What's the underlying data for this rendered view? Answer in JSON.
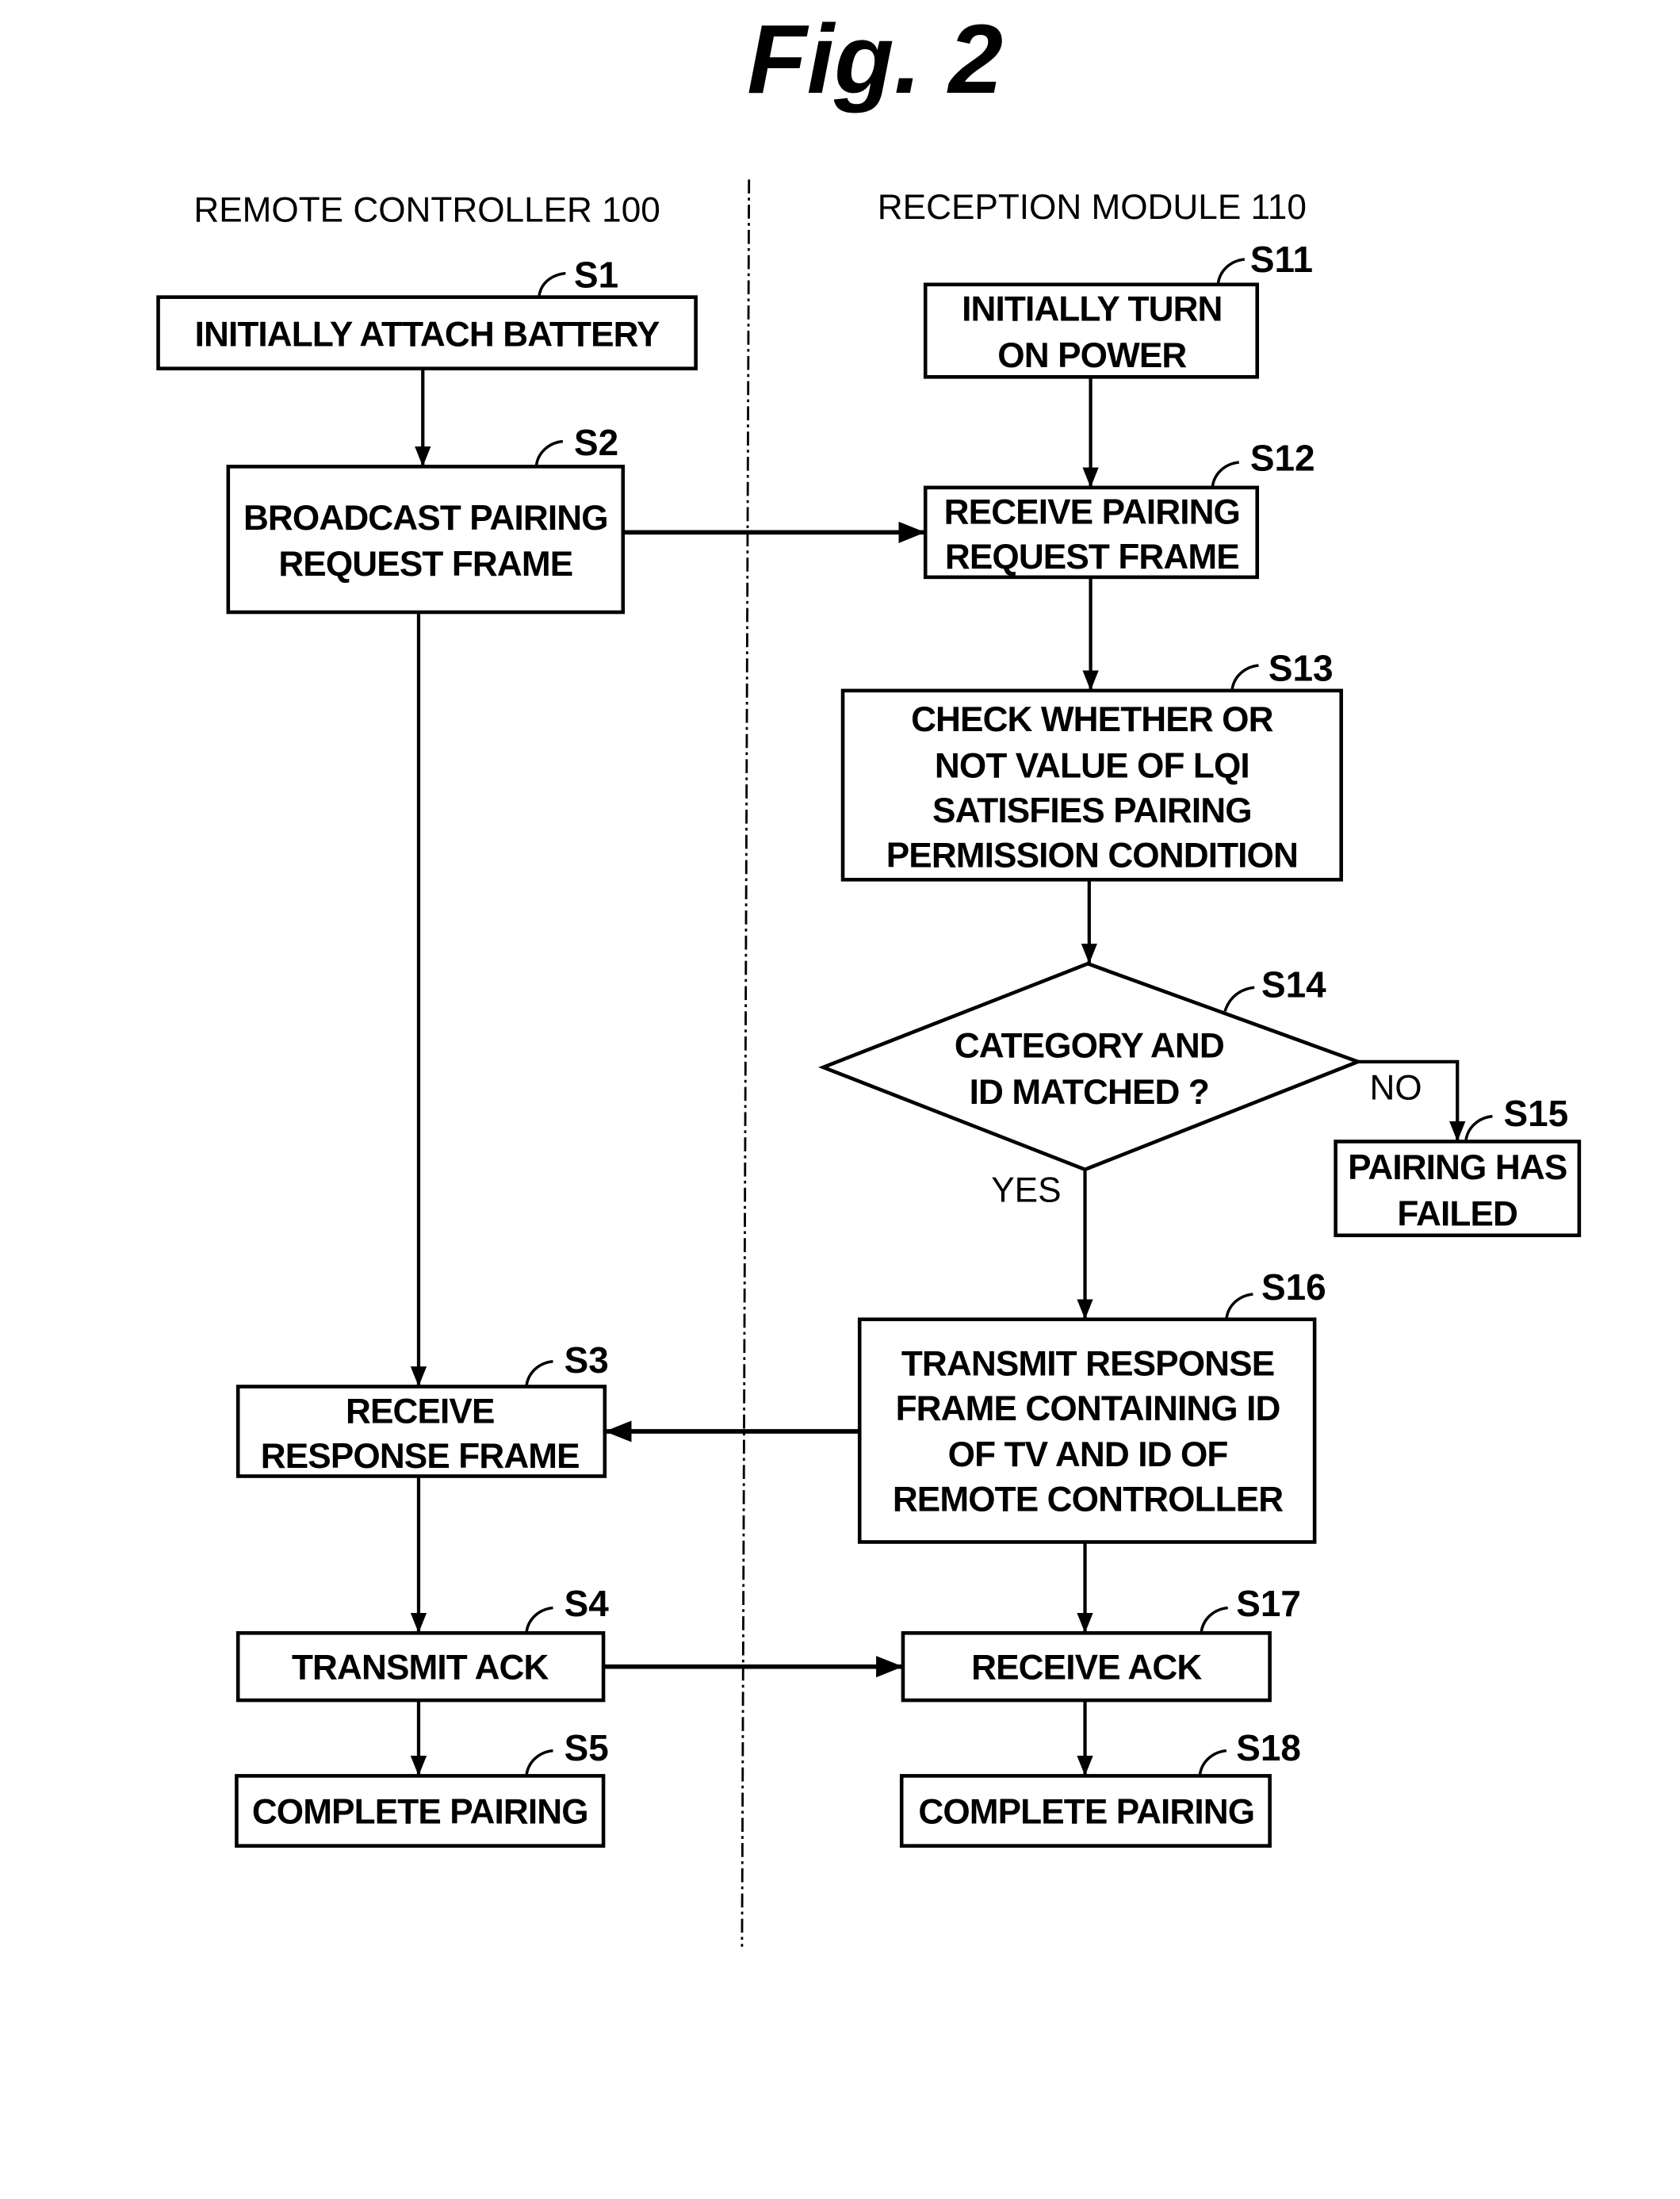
{
  "figure": {
    "title": "Fig. 2",
    "lanes": {
      "left": "REMOTE CONTROLLER 100",
      "right": "RECEPTION MODULE 110"
    },
    "steps": {
      "S1": {
        "id": "S1",
        "lines": [
          "INITIALLY ATTACH BATTERY"
        ]
      },
      "S2": {
        "id": "S2",
        "lines": [
          "BROADCAST PAIRING",
          "REQUEST FRAME"
        ]
      },
      "S3": {
        "id": "S3",
        "lines": [
          "RECEIVE",
          "RESPONSE FRAME"
        ]
      },
      "S4": {
        "id": "S4",
        "lines": [
          "TRANSMIT ACK"
        ]
      },
      "S5": {
        "id": "S5",
        "lines": [
          "COMPLETE PAIRING"
        ]
      },
      "S11": {
        "id": "S11",
        "lines": [
          "INITIALLY TURN",
          "ON POWER"
        ]
      },
      "S12": {
        "id": "S12",
        "lines": [
          "RECEIVE PAIRING",
          "REQUEST FRAME"
        ]
      },
      "S13": {
        "id": "S13",
        "lines": [
          "CHECK WHETHER OR",
          "NOT VALUE OF LQI",
          "SATISFIES PAIRING",
          "PERMISSION CONDITION"
        ]
      },
      "S14": {
        "id": "S14",
        "lines": [
          "CATEGORY AND",
          "ID MATCHED ?"
        ]
      },
      "S15": {
        "id": "S15",
        "lines": [
          "PAIRING HAS",
          "FAILED"
        ]
      },
      "S16": {
        "id": "S16",
        "lines": [
          "TRANSMIT RESPONSE",
          "FRAME CONTAINING ID",
          "OF TV AND ID OF",
          "REMOTE CONTROLLER"
        ]
      },
      "S17": {
        "id": "S17",
        "lines": [
          "RECEIVE ACK"
        ]
      },
      "S18": {
        "id": "S18",
        "lines": [
          "COMPLETE PAIRING"
        ]
      }
    },
    "branch_labels": {
      "yes": "YES",
      "no": "NO"
    }
  }
}
